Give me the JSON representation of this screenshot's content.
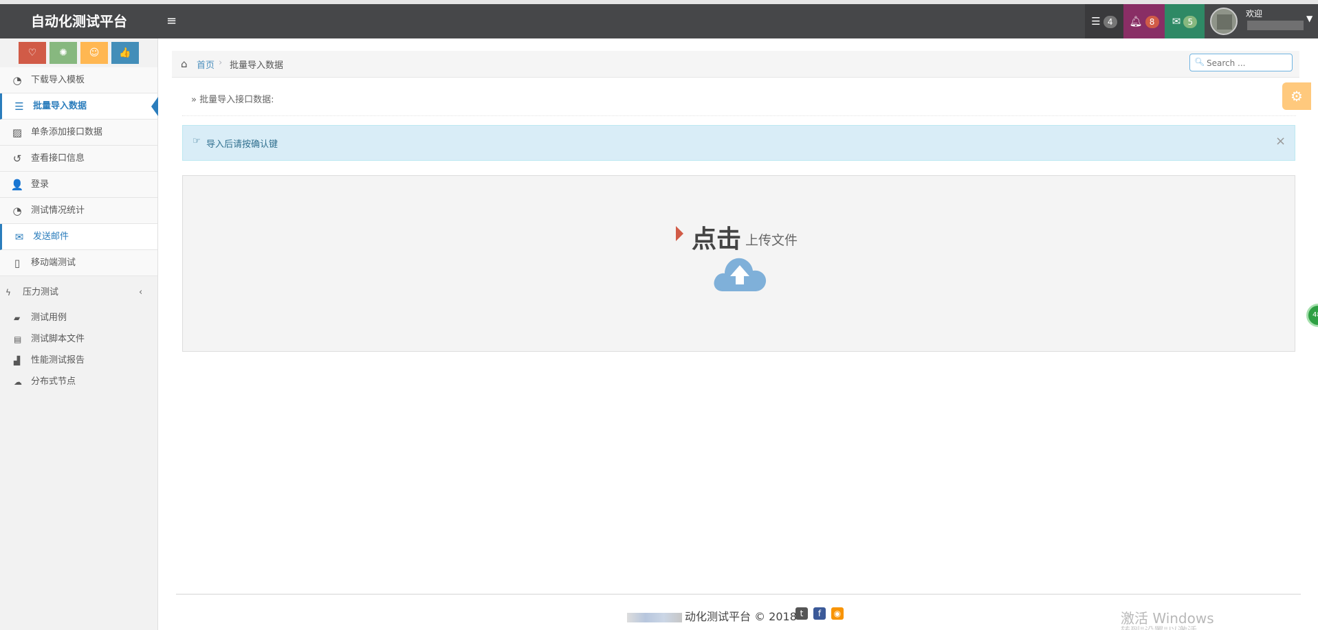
{
  "app": {
    "title": "自动化测试平台"
  },
  "navbar": {
    "menu_icon": "≡",
    "tasks_badge": "4",
    "notifications_badge": "8",
    "messages_badge": "5",
    "welcome": "欢迎"
  },
  "shortcuts": [
    {
      "icon": "heart-icon",
      "glyph": "♡",
      "color": "#d15b47"
    },
    {
      "icon": "spinner-icon",
      "glyph": "✺",
      "color": "#87b87f"
    },
    {
      "icon": "smile-icon",
      "glyph": "☺",
      "color": "#ffb752"
    },
    {
      "icon": "thumbs-up-icon",
      "glyph": "👍",
      "color": "#438eb9"
    }
  ],
  "sidebar": {
    "items": [
      {
        "label": "下载导入模板",
        "icon": "pie-chart-icon",
        "glyph": "◔"
      },
      {
        "label": "批量导入数据",
        "icon": "list-icon",
        "glyph": "☰"
      },
      {
        "label": "单条添加接口数据",
        "icon": "picture-icon",
        "glyph": "▨"
      },
      {
        "label": "查看接口信息",
        "icon": "history-icon",
        "glyph": "↺"
      },
      {
        "label": "登录",
        "icon": "user-plus-icon",
        "glyph": "👤"
      },
      {
        "label": "测试情况统计",
        "icon": "pie-chart-icon",
        "glyph": "◔"
      },
      {
        "label": "发送邮件",
        "icon": "envelope-icon",
        "glyph": "✉"
      },
      {
        "label": "移动端测试",
        "icon": "mobile-icon",
        "glyph": "▯"
      }
    ],
    "group": {
      "label": "压力测试",
      "glyph": "ϟ",
      "arrow": "‹"
    },
    "sub_items": [
      {
        "label": "测试用例",
        "icon": "briefcase-icon",
        "glyph": "▰"
      },
      {
        "label": "测试脚本文件",
        "icon": "file-icon",
        "glyph": "▤"
      },
      {
        "label": "性能测试报告",
        "icon": "area-chart-icon",
        "glyph": "▟"
      },
      {
        "label": "分布式节点",
        "icon": "cloud-icon",
        "glyph": "☁"
      }
    ]
  },
  "breadcrumb": {
    "home": "首页",
    "separator": "›",
    "current": "批量导入数据"
  },
  "search": {
    "placeholder": "Search ..."
  },
  "page_header": {
    "text": "» 批量导入接口数据:"
  },
  "alert": {
    "icon_glyph": "☞",
    "text": "导入后请按确认键",
    "close": "×"
  },
  "upload": {
    "big": "点击",
    "small": "上传文件"
  },
  "footer": {
    "text": "动化测试平台 © 2018"
  },
  "watermark": {
    "line1": "激活 Windows",
    "line2": "转到\"设置\"以激活 Windows。"
  },
  "colors": {
    "accent": "#2b7dbc",
    "navbar": "#464749",
    "alert_bg": "#d9edf7"
  }
}
